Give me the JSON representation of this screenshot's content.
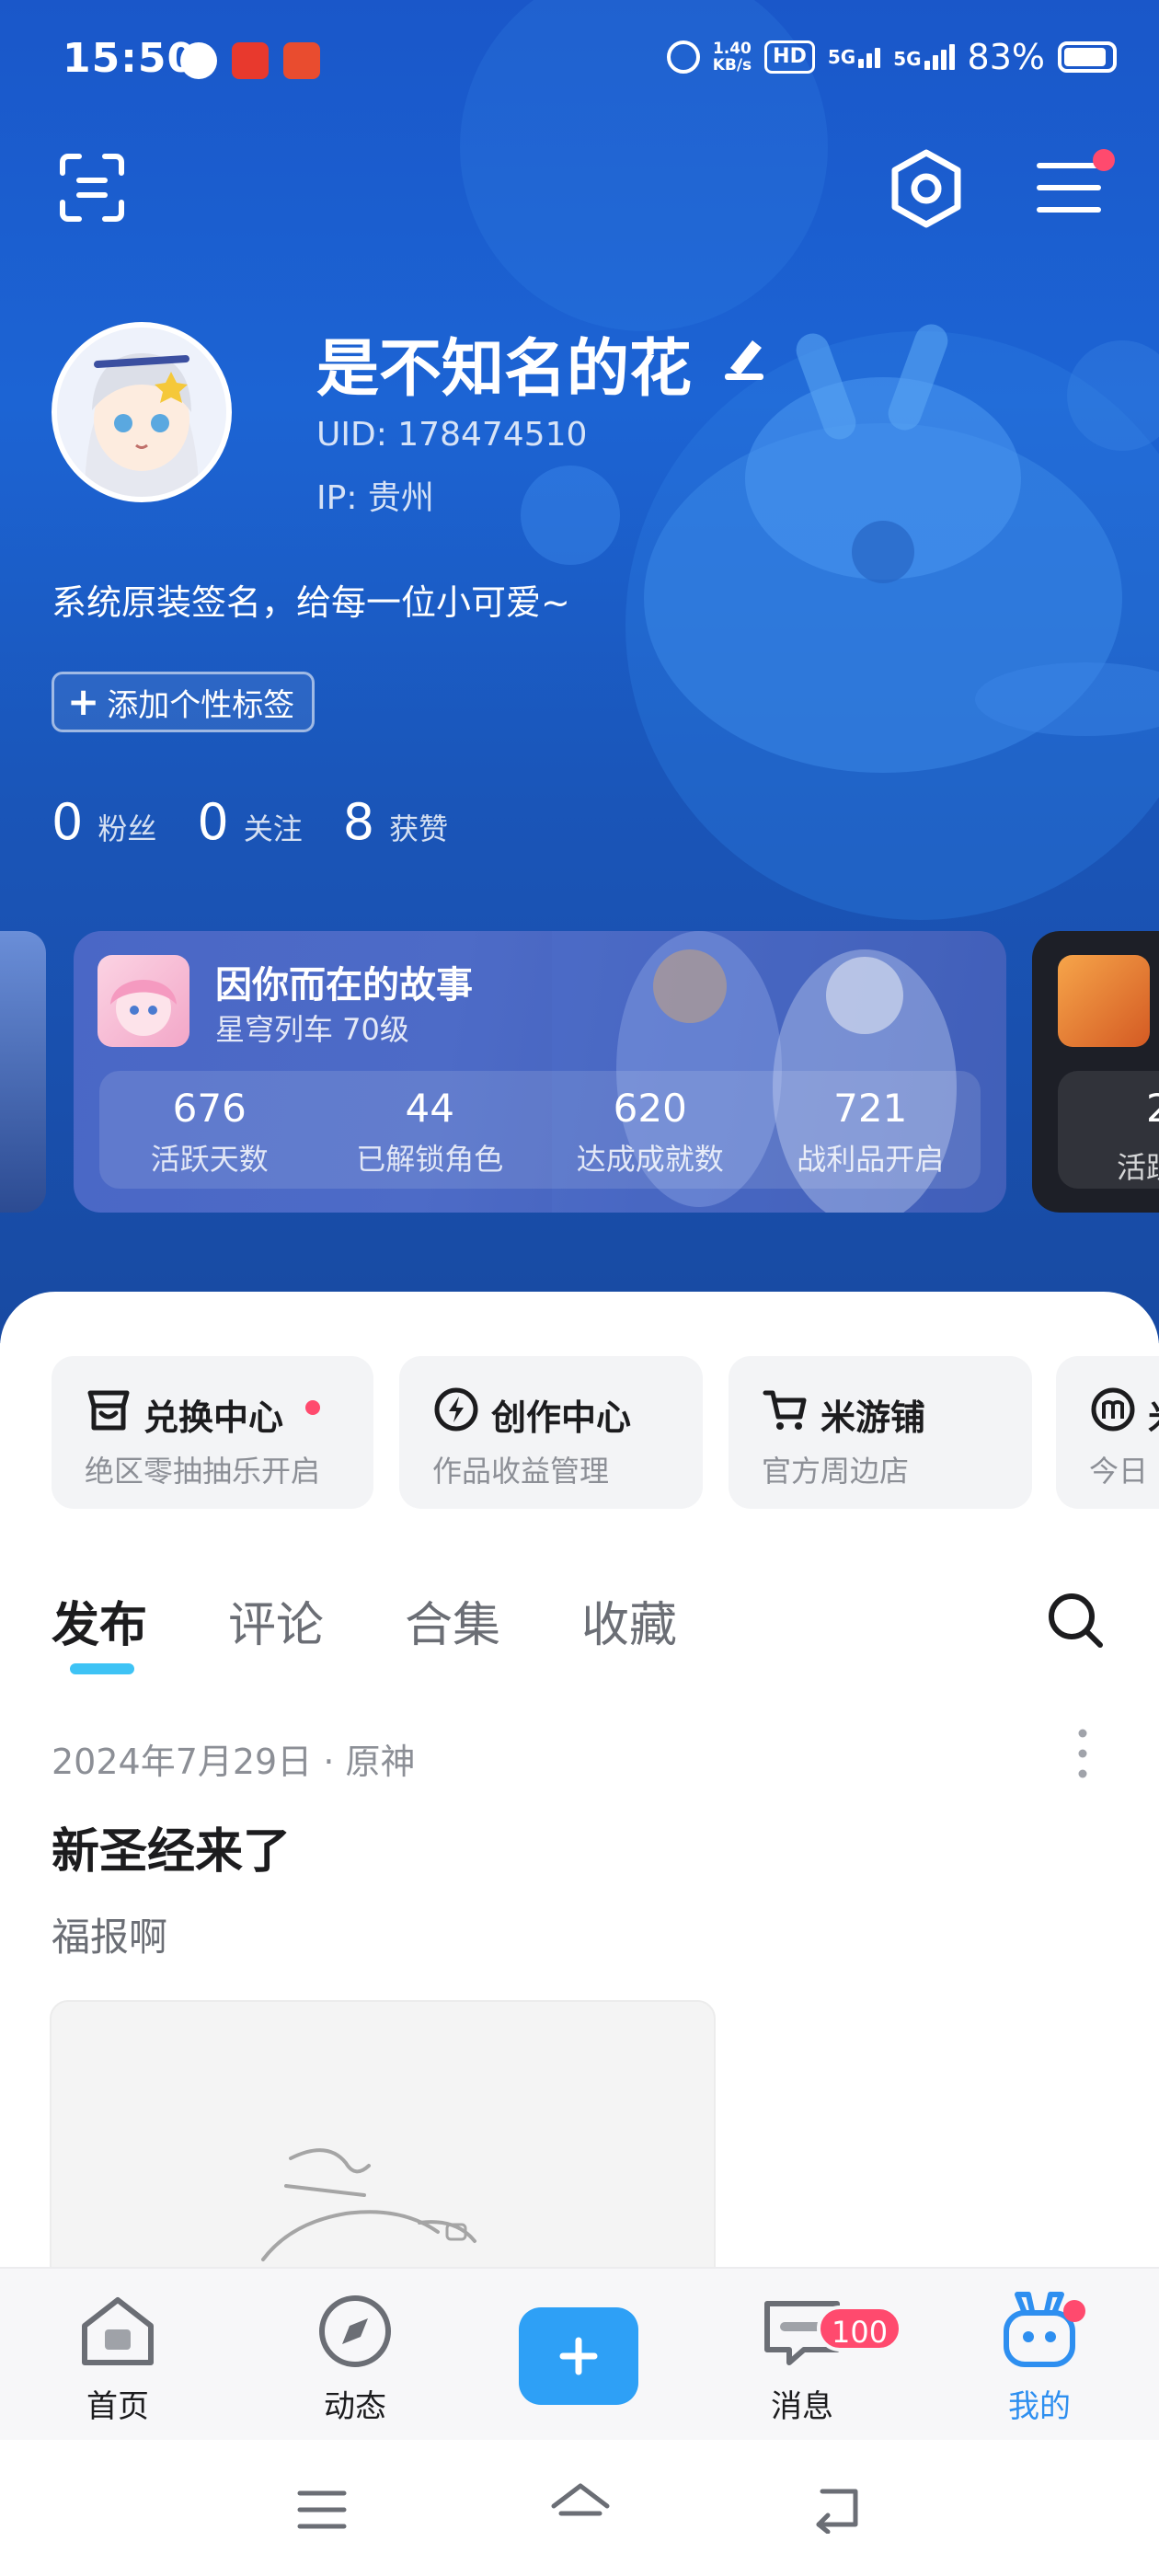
{
  "status_bar": {
    "time": "15:50",
    "net_speed_value": "1.40",
    "net_speed_unit": "KB/s",
    "hd_label": "HD",
    "signal_1": "5G",
    "signal_2": "5G",
    "battery": "83%"
  },
  "profile": {
    "nickname": "是不知名的花",
    "uid": "UID: 178474510",
    "ip": "IP: 贵州",
    "signature": "系统原装签名，给每一位小可爱~",
    "add_tag_label": "添加个性标签",
    "stats": [
      {
        "value": "0",
        "label": "粉丝"
      },
      {
        "value": "0",
        "label": "关注"
      },
      {
        "value": "8",
        "label": "获赞"
      }
    ]
  },
  "game_card": {
    "title": "因你而在的故事",
    "subtitle": "星穹列车 70级",
    "stats": [
      {
        "value": "676",
        "label": "活跃天数"
      },
      {
        "value": "44",
        "label": "已解锁角色"
      },
      {
        "value": "620",
        "label": "达成成就数"
      },
      {
        "value": "721",
        "label": "战利品开启"
      }
    ],
    "next_card_value": "2",
    "next_card_label": "活跃"
  },
  "shortcuts": [
    {
      "title": "兑换中心",
      "subtitle": "绝区零抽抽乐开启",
      "icon": "store-icon"
    },
    {
      "title": "创作中心",
      "subtitle": "作品收益管理",
      "icon": "lightning-icon"
    },
    {
      "title": "米游铺",
      "subtitle": "官方周边店",
      "icon": "cart-icon"
    },
    {
      "title": "米",
      "subtitle": "今日",
      "icon": "m-icon"
    }
  ],
  "tabs": [
    "发布",
    "评论",
    "合集",
    "收藏"
  ],
  "post": {
    "meta": "2024年7月29日 · 原神",
    "title": "新圣经来了",
    "body": "福报啊"
  },
  "bottom_nav": [
    {
      "label": "首页",
      "icon": "home-icon"
    },
    {
      "label": "动态",
      "icon": "compass-icon"
    },
    {
      "label": "",
      "icon": "plus-icon"
    },
    {
      "label": "消息",
      "icon": "message-icon"
    },
    {
      "label": "我的",
      "icon": "mine-icon"
    }
  ],
  "message_badge": "100",
  "colors": {
    "accent": "#2ea0f6",
    "header_blue": "#1c64d4",
    "badge_red": "#ff4a6e",
    "tab_indicator": "#3ec3f5"
  }
}
